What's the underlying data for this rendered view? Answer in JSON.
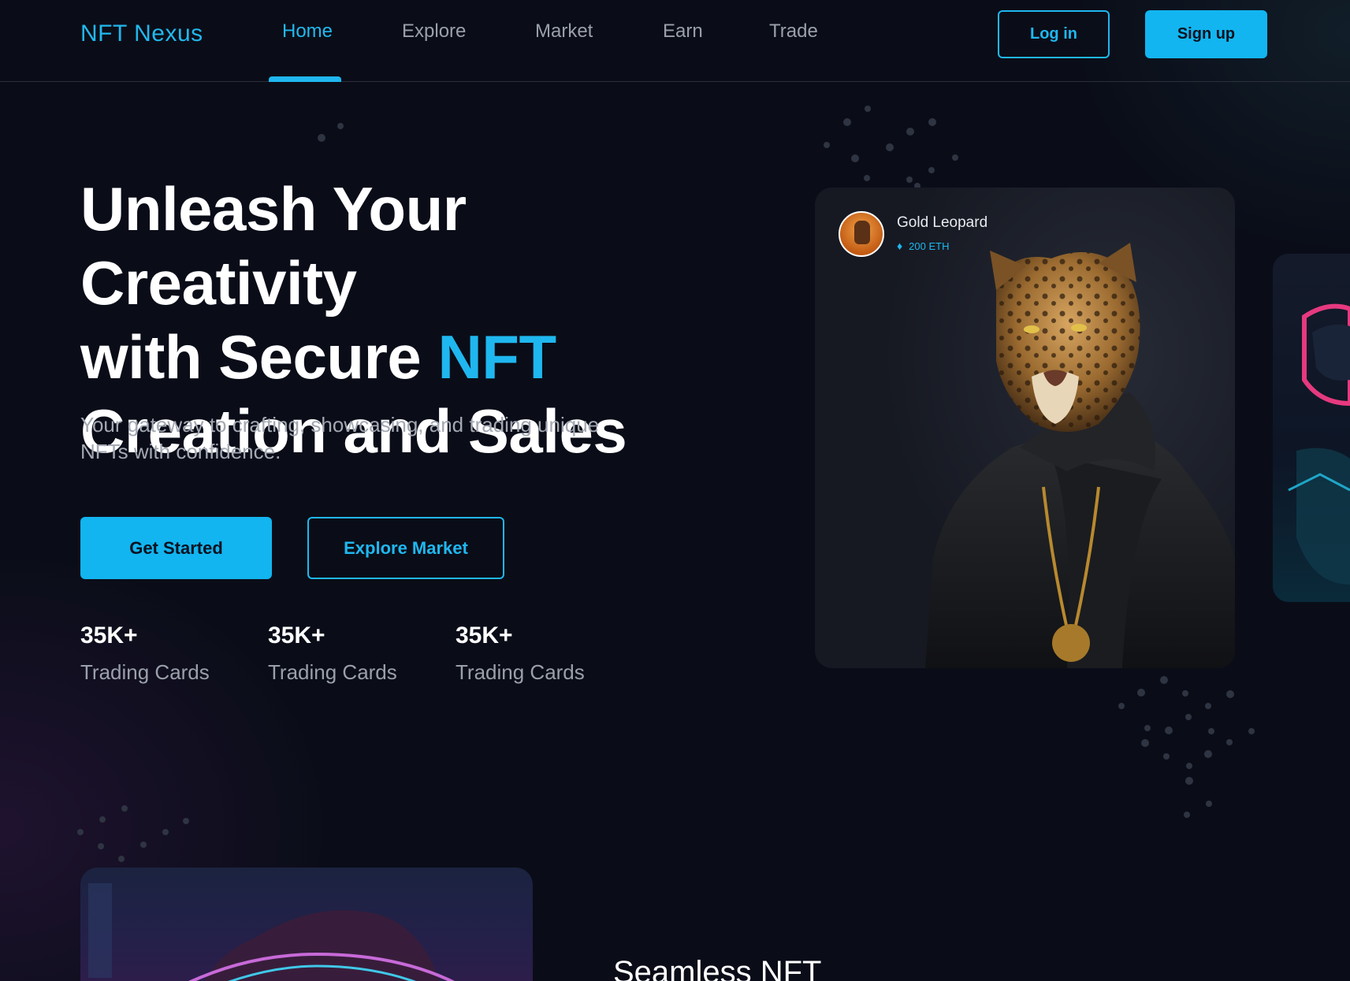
{
  "brand": {
    "logo": "NFT Nexus"
  },
  "nav": {
    "items": [
      {
        "label": "Home",
        "active": true
      },
      {
        "label": "Explore",
        "active": false
      },
      {
        "label": "Market",
        "active": false
      },
      {
        "label": "Earn",
        "active": false
      },
      {
        "label": "Trade",
        "active": false
      }
    ],
    "login_label": "Log in",
    "signup_label": "Sign up"
  },
  "hero": {
    "title_line1": "Unleash Your Creativity",
    "title_line2_pre": "with Secure ",
    "title_line2_accent": "NFT",
    "title_line3": "Creation and Sales",
    "subtitle": "Your gateway to crafting, showcasing, and trading unique NFTs with confidence.",
    "primary_cta": "Get Started",
    "secondary_cta": "Explore Market"
  },
  "stats": [
    {
      "value": "35K+",
      "label": "Trading Cards"
    },
    {
      "value": "35K+",
      "label": "Trading Cards"
    },
    {
      "value": "35K+",
      "label": "Trading Cards"
    }
  ],
  "featured_nft": {
    "name": "Gold Leopard",
    "price": "200 ETH",
    "icon": "ethereum-icon"
  },
  "section": {
    "heading": "Seamless NFT"
  },
  "colors": {
    "accent": "#1fb7ef",
    "background": "#0a0d18",
    "muted_text": "#9aa0ab"
  }
}
